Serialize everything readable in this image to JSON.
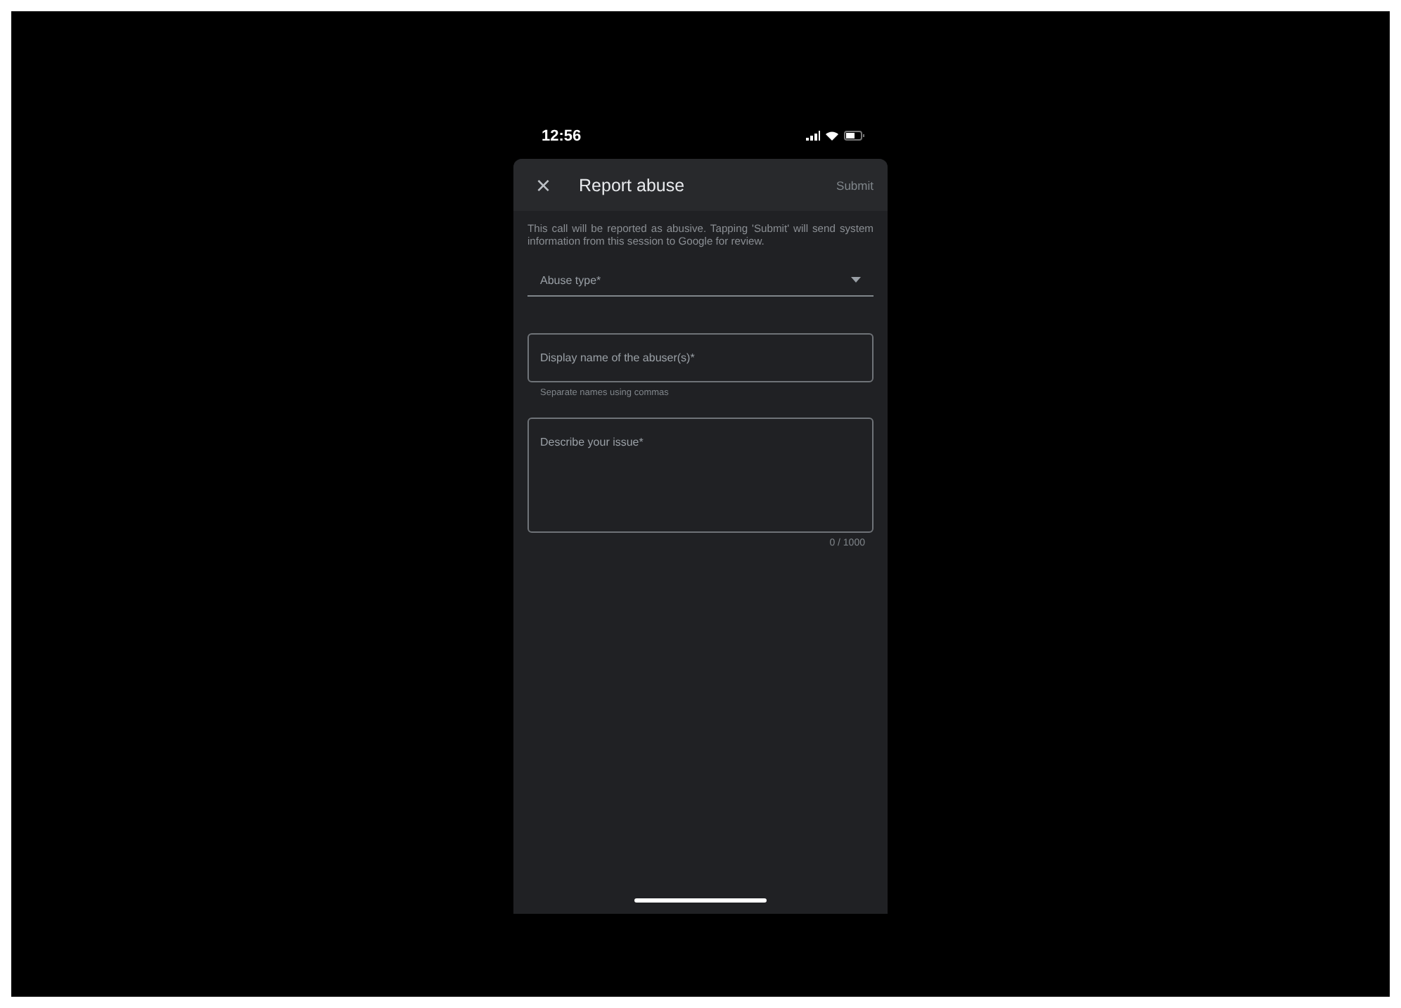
{
  "status_bar": {
    "time": "12:56"
  },
  "header": {
    "close": "×",
    "title": "Report abuse",
    "action": "Submit"
  },
  "notice": "This call will be reported as abusive. Tapping 'Submit' will send system information from this session to Google for review.",
  "fields": [
    {
      "kind": "dropdown",
      "placeholder": "Abuse type*"
    },
    {
      "kind": "text",
      "placeholder": "Display name of the abuser(s)*",
      "helper": "Separate names using commas"
    },
    {
      "kind": "textarea",
      "placeholder": "Describe your issue*",
      "counter": "0 / 1000"
    }
  ]
}
